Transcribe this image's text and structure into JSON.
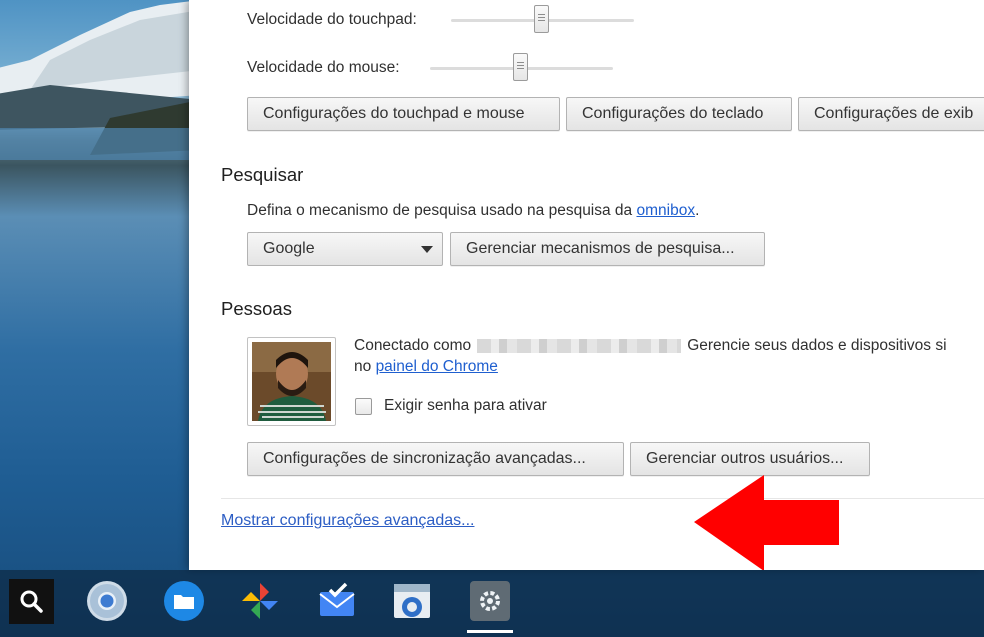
{
  "mouse_section": {
    "touchpad_speed_label": "Velocidade do touchpad:",
    "touchpad_speed": 0.5,
    "mouse_speed_label": "Velocidade do mouse:",
    "mouse_speed": 0.5,
    "buttons": {
      "touchpad_mouse": "Configurações do touchpad e mouse",
      "keyboard": "Configurações do teclado",
      "display": "Configurações de exib"
    }
  },
  "search_section": {
    "title": "Pesquisar",
    "description_prefix": "Defina o mecanismo de pesquisa usado na pesquisa da ",
    "description_link": "omnibox",
    "description_suffix": ".",
    "engine_selected": "Google",
    "manage_button": "Gerenciar mecanismos de pesquisa..."
  },
  "people_section": {
    "title": "Pessoas",
    "connected_prefix": "Conectado como",
    "connected_suffix": "Gerencie seus dados e dispositivos si",
    "line2_prefix": "no ",
    "dashboard_link": "painel do Chrome",
    "require_password_label": "Exigir senha para ativar",
    "require_password_checked": false,
    "sync_button": "Configurações de sincronização avançadas...",
    "manage_users_button": "Gerenciar outros usuários..."
  },
  "advanced_link": "Mostrar configurações avançadas...",
  "colors": {
    "link": "#1f5fcf",
    "arrow": "#ff0000"
  },
  "shelf": {
    "icons": [
      "search-icon",
      "chrome-icon",
      "files-icon",
      "photos-icon",
      "inbox-icon",
      "webstore-icon",
      "settings-icon"
    ]
  }
}
